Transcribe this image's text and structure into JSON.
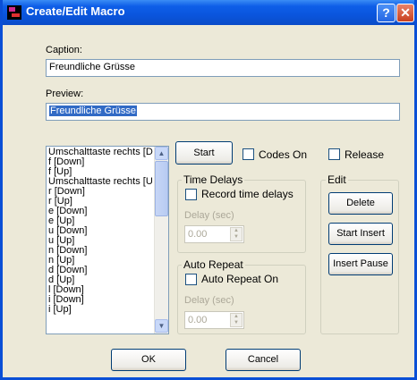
{
  "window": {
    "title": "Create/Edit Macro",
    "help_glyph": "?",
    "close_glyph": "✕"
  },
  "caption": {
    "label": "Caption:",
    "value": "Freundliche Grüsse"
  },
  "preview": {
    "label": "Preview:",
    "value": "Freundliche Grüsse"
  },
  "keystrokes": {
    "items": [
      "Umschalttaste rechts [D",
      "f [Down]",
      "f [Up]",
      "Umschalttaste rechts [U",
      "r [Down]",
      "r [Up]",
      "e [Down]",
      "e [Up]",
      "u [Down]",
      "u [Up]",
      "n [Down]",
      "n [Up]",
      "d [Down]",
      "d [Up]",
      "l [Down]",
      "i [Down]",
      "i [Up]"
    ]
  },
  "record": {
    "start_label": "Start",
    "codes_on_label": "Codes On",
    "release_label": "Release",
    "codes_on_checked": false,
    "release_checked": false
  },
  "time_delays": {
    "title": "Time Delays",
    "record_label": "Record time delays",
    "record_checked": false,
    "delay_label": "Delay (sec)",
    "delay_value": "0.00"
  },
  "auto_repeat": {
    "title": "Auto Repeat",
    "on_label": "Auto Repeat On",
    "on_checked": false,
    "delay_label": "Delay (sec)",
    "delay_value": "0.00"
  },
  "edit": {
    "title": "Edit",
    "delete_label": "Delete",
    "start_insert_label": "Start Insert",
    "insert_pause_label": "Insert Pause"
  },
  "dialog": {
    "ok_label": "OK",
    "cancel_label": "Cancel"
  },
  "colors": {
    "titlebar": "#0a55dd",
    "dialog_bg": "#ece9d8",
    "selection": "#316ac5",
    "button_border": "#003c74"
  }
}
